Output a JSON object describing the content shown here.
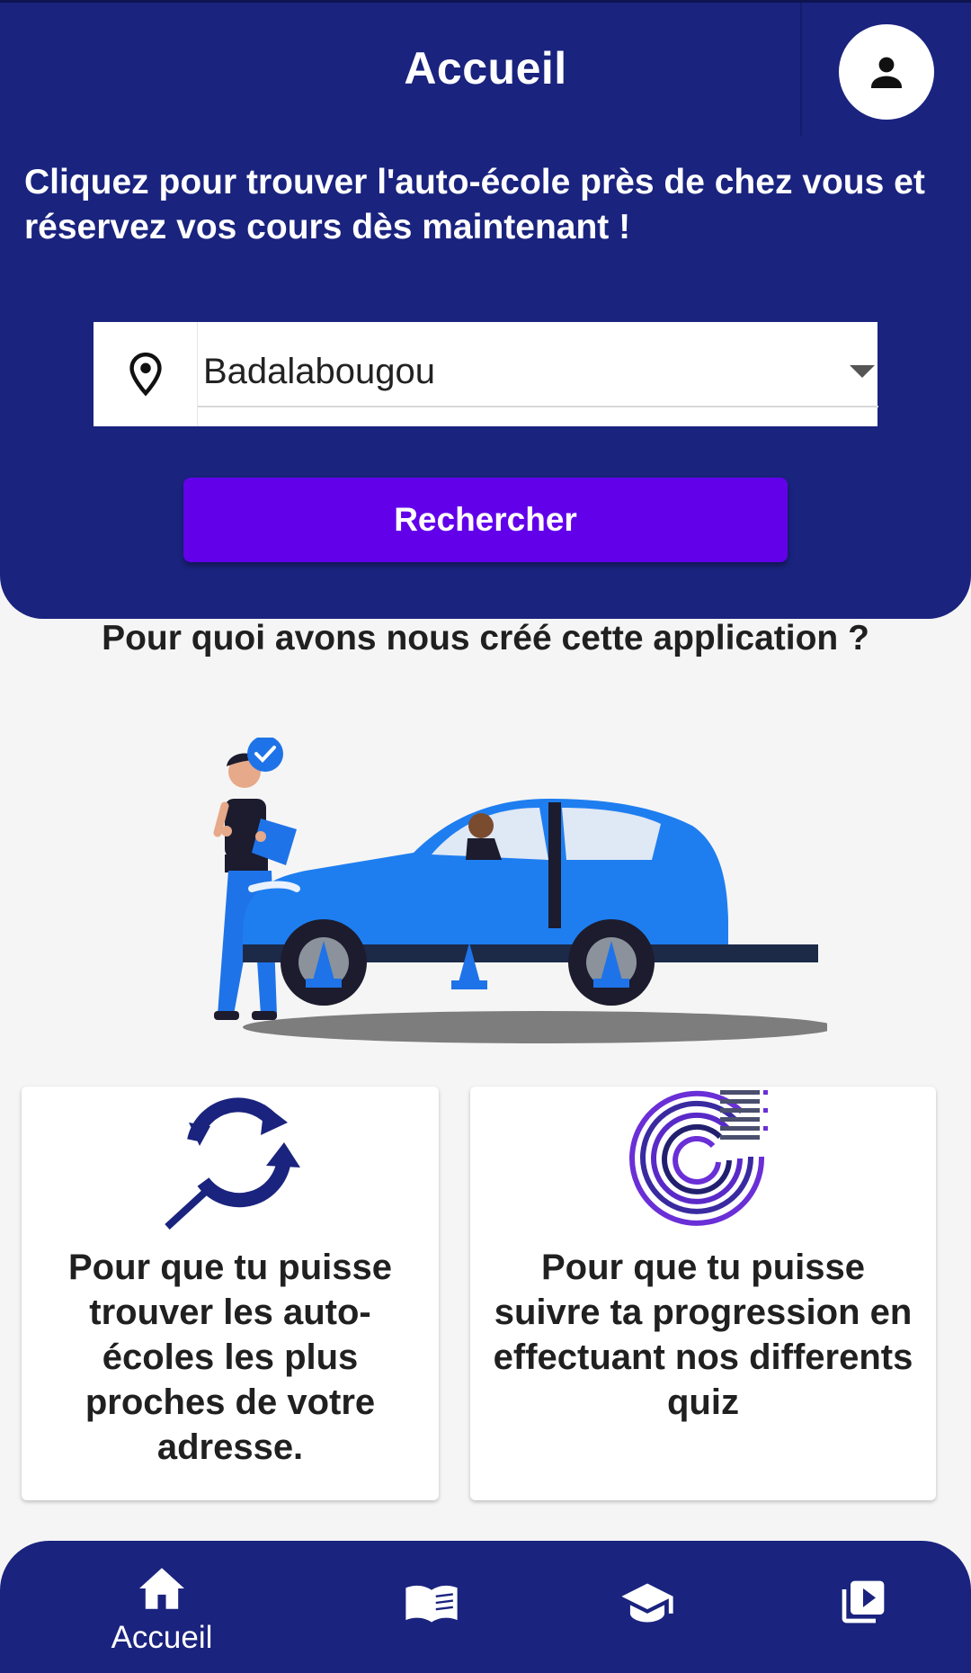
{
  "header": {
    "title": "Accueil",
    "profile_icon": "person-icon",
    "background_color": "#1a237e"
  },
  "intro": {
    "text": "Cliquez pour trouver l'auto-école près de chez vous et réservez vos cours dès maintenant !"
  },
  "location": {
    "icon": "location-pin-icon",
    "selected_value": "Badalabougou"
  },
  "search_button": {
    "label": "Rechercher",
    "color": "#6200ea"
  },
  "section": {
    "title": "Pour quoi avons nous créé cette application ?"
  },
  "cards": [
    {
      "icon": "search-refresh-icon",
      "text": "Pour que tu puisse trouver les auto-écoles les plus proches de votre adresse."
    },
    {
      "icon": "progress-rings-icon",
      "text": "Pour que tu puisse suivre ta progression en effectuant nos differents quiz"
    }
  ],
  "bottom_nav": {
    "items": [
      {
        "icon": "home-icon",
        "label": "Accueil",
        "active": true
      },
      {
        "icon": "book-icon",
        "label": ""
      },
      {
        "icon": "graduation-cap-icon",
        "label": ""
      },
      {
        "icon": "video-library-icon",
        "label": ""
      }
    ]
  }
}
